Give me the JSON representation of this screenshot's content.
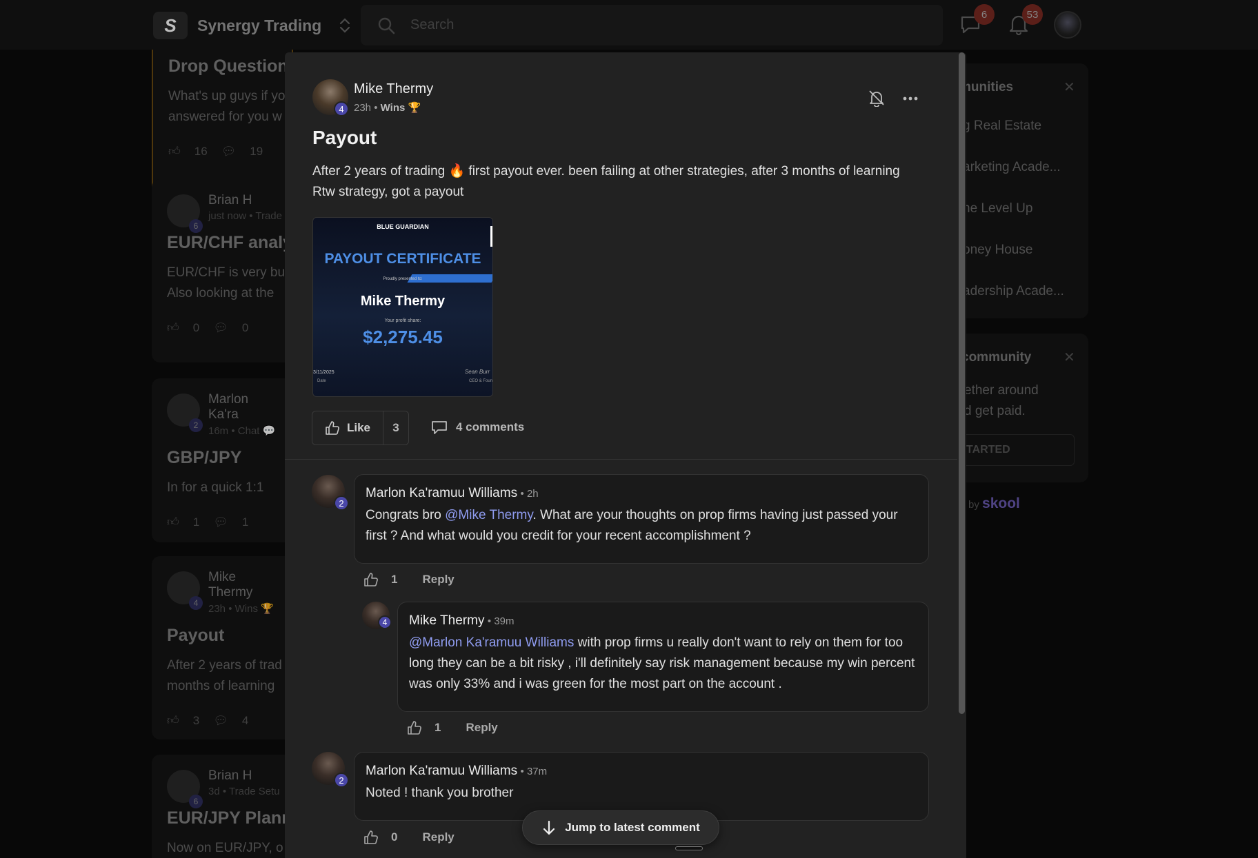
{
  "topbar": {
    "brand_logo_letter": "S",
    "brand_name": "Synergy Trading",
    "search_placeholder": "Search",
    "chat_badge": "6",
    "notif_badge": "53"
  },
  "feed": [
    {
      "name": "",
      "meta": "",
      "title": "Drop Questions",
      "body": "What's up guys if yo\nanswered for you w",
      "likes": "16",
      "comments": "19"
    },
    {
      "name": "Brian H",
      "meta": "just now • Trade",
      "level": "6",
      "title": "EUR/CHF analy",
      "body": "EUR/CHF is very bu\nAlso looking at the",
      "likes": "0",
      "comments": "0"
    },
    {
      "name": "Marlon Ka'ra",
      "meta": "16m • Chat 💬",
      "level": "2",
      "title": "GBP/JPY",
      "body": "In for a quick 1:1",
      "likes": "1",
      "comments": "1"
    },
    {
      "name": "Mike Thermy",
      "meta": "23h • Wins 🏆",
      "level": "4",
      "title": "Payout",
      "body": "After 2 years of trad\nmonths of learning",
      "likes": "3",
      "comments": "4"
    },
    {
      "name": "Brian H",
      "meta": "3d • Trade Setu",
      "level": "6",
      "title": "EUR/JPY Plann",
      "body": "Now on EUR/JPY, o",
      "likes": "",
      "comments": ""
    }
  ],
  "right_panel": {
    "communities_title": "munities",
    "communities": [
      "g Real Estate",
      "arketing Acade...",
      "he Level Up",
      "oney House",
      "adership Acade..."
    ],
    "invite_title": "community",
    "invite_text": "ether around\nd get paid.",
    "invite_button": "TARTED",
    "powered_prefix": "by",
    "powered_brand": "skool"
  },
  "post": {
    "author": "Mike Thermy",
    "level": "4",
    "time": "23h",
    "category": "Wins 🏆",
    "title": "Payout",
    "body": "After 2 years of trading 🔥 first payout ever. been failing at other strategies, after 3 months of learning Rtw strategy, got a payout",
    "certificate": {
      "brand": "BLUE GUARDIAN",
      "title": "PAYOUT CERTIFICATE",
      "presented": "Proudly presented to:",
      "name": "Mike Thermy",
      "profit_label": "Your profit share:",
      "amount": "$2,275.45",
      "date": "3/11/2025",
      "date_label": "Date",
      "signature": "Sean Burr",
      "ceo_label": "CEO & Foun"
    },
    "like_label": "Like",
    "like_count": "3",
    "comments_label": "4 comments"
  },
  "comments": [
    {
      "author": "Marlon Ka'ramuu Williams",
      "level": "2",
      "time": "2h",
      "text_before": "Congrats bro ",
      "mention": "@Mike Thermy",
      "text_after": ". What are your thoughts on prop firms having just passed your first ? And what would you credit for your recent accomplishment ?",
      "likes": "1",
      "reply": "Reply"
    },
    {
      "author": "Mike Thermy",
      "level": "4",
      "time": "39m",
      "text_before": "",
      "mention": "@Marlon Ka'ramuu Williams",
      "text_after": " with prop firms u really don't want to rely on them for too long they can be a bit risky , i'll definitely say risk management because my win percent was only 33% and i was green for the most part on the account .",
      "likes": "1",
      "reply": "Reply"
    },
    {
      "author": "Marlon Ka'ramuu Williams",
      "level": "2",
      "time": "37m",
      "text_before": "Noted ! thank you brother",
      "mention": "",
      "text_after": "",
      "likes": "0",
      "reply": "Reply"
    }
  ],
  "jump_label": "Jump to latest comment"
}
